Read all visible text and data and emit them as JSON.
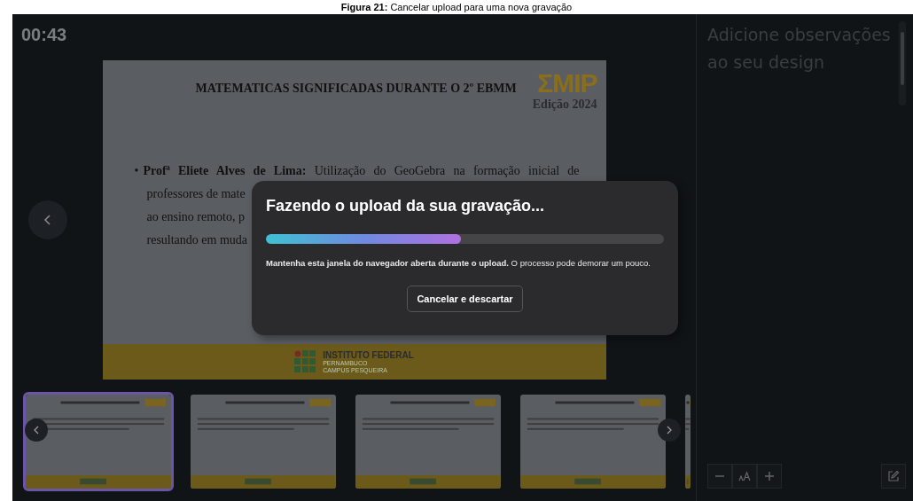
{
  "caption": "**Figura 21:** Cancelar upload para uma nova gravação",
  "timer": "00:43",
  "slide": {
    "title": "MATEMATICAS SIGNIFICADAS DURANTE O 2º  EBMM",
    "logo": "ΣMIP",
    "edition": "Edição 2024",
    "bullet": "•",
    "lines": [
      "**Profª Eliete Alves de Lima:** Utilização do GeoGebra na formação inicial de",
      "professores de mate",
      "ao ensino remoto, p",
      "resultando em muda"
    ],
    "footer": {
      "name": "INSTITUTO FEDERAL",
      "state": "PERNAMBUCO",
      "campus": "CAMPUS PESQUEIRA"
    }
  },
  "dialog": {
    "title": "Fazendo o upload da sua gravação...",
    "level": 0.49,
    "message": "**Mantenha esta janela do navegador aberta durante o upload.** O processo pode demorar um pouco.",
    "button": "Cancelar e descartar"
  },
  "thumbnails": [
    {
      "selected": true
    },
    {
      "selected": false
    },
    {
      "selected": false
    },
    {
      "selected": false
    },
    {
      "selected": false
    }
  ],
  "notes": {
    "placeholder": "Adicione observações ao seu design"
  }
}
